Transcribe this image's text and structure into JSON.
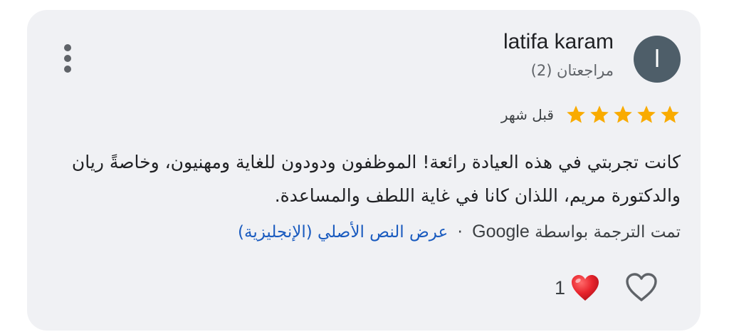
{
  "review": {
    "user": {
      "initial": "l",
      "name": "latifa karam",
      "reviews_count": "مراجعتان (2)"
    },
    "rating": {
      "stars": 5,
      "max_stars": 5,
      "star_color": "#f9ab00"
    },
    "date": "قبل شهر",
    "text": "كانت تجربتي في هذه العيادة رائعة! الموظفون ودودون للغاية ومهنيون، وخاصةً ريان والدكتورة مريم، اللذان كانا في غاية اللطف والمساعدة.",
    "translation": {
      "prefix": "تمت الترجمة بواسطة",
      "provider": "Google",
      "separator": "·",
      "show_original": "عرض النص الأصلي (الإنجليزية)"
    },
    "reactions": {
      "heart_count": "1",
      "heart_color": "#e8242c"
    },
    "icons": {
      "more": "more-vert-icon",
      "like": "heart-outline-icon",
      "reaction": "heart-filled-icon",
      "star": "star-icon"
    }
  }
}
